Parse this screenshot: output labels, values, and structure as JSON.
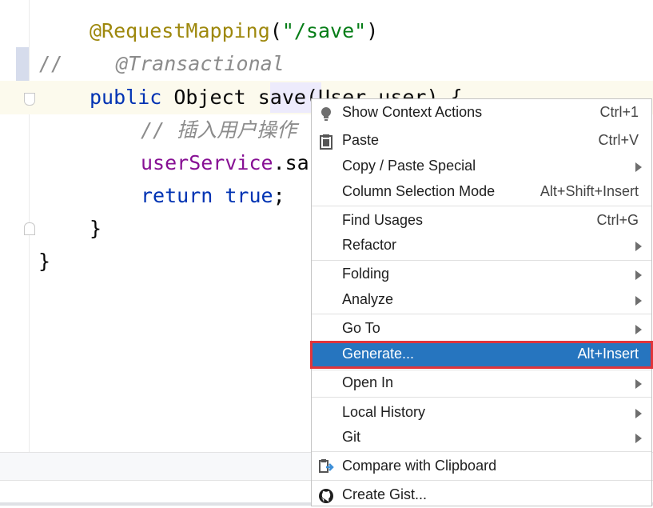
{
  "editor": {
    "line1": {
      "annotation": "@RequestMapping",
      "open": "(",
      "string": "\"/save\"",
      "close": ")"
    },
    "line2": {
      "comment_prefix": "//",
      "annotation": "@Transactional"
    },
    "line3": {
      "kw_public": "public",
      "type": "Object",
      "method": "save",
      "params": "(User user) {"
    },
    "line4": {
      "comment": "// 插入用户操作"
    },
    "line5": {
      "field": "userService",
      "rest": ".sa"
    },
    "line6": {
      "kw_return": "return",
      "kw_true": "true",
      "semicolon": ";"
    },
    "line7": {
      "brace": "}"
    },
    "line8": {
      "brace": "}"
    }
  },
  "context_menu": {
    "items": [
      {
        "label": "Show Context Actions",
        "shortcut": "Ctrl+1",
        "icon": "lightbulb-icon"
      },
      {
        "label": "Paste",
        "shortcut": "Ctrl+V",
        "icon": "clipboard-icon"
      },
      {
        "label": "Copy / Paste Special",
        "submenu": true
      },
      {
        "label": "Column Selection Mode",
        "shortcut": "Alt+Shift+Insert"
      },
      {
        "label": "Find Usages",
        "shortcut": "Ctrl+G"
      },
      {
        "label": "Refactor",
        "submenu": true
      },
      {
        "label": "Folding",
        "submenu": true
      },
      {
        "label": "Analyze",
        "submenu": true
      },
      {
        "label": "Go To",
        "submenu": true
      },
      {
        "label": "Generate...",
        "shortcut": "Alt+Insert",
        "selected": true
      },
      {
        "label": "Open In",
        "submenu": true
      },
      {
        "label": "Local History",
        "submenu": true
      },
      {
        "label": "Git",
        "submenu": true
      },
      {
        "label": "Compare with Clipboard",
        "icon": "compare-icon"
      },
      {
        "label": "Create Gist...",
        "icon": "github-icon"
      }
    ]
  },
  "colors": {
    "selection": "#2675bf",
    "highlight_border": "#e0353b",
    "keyword": "#0033b3",
    "annotation": "#9e880d",
    "string": "#067d17"
  }
}
